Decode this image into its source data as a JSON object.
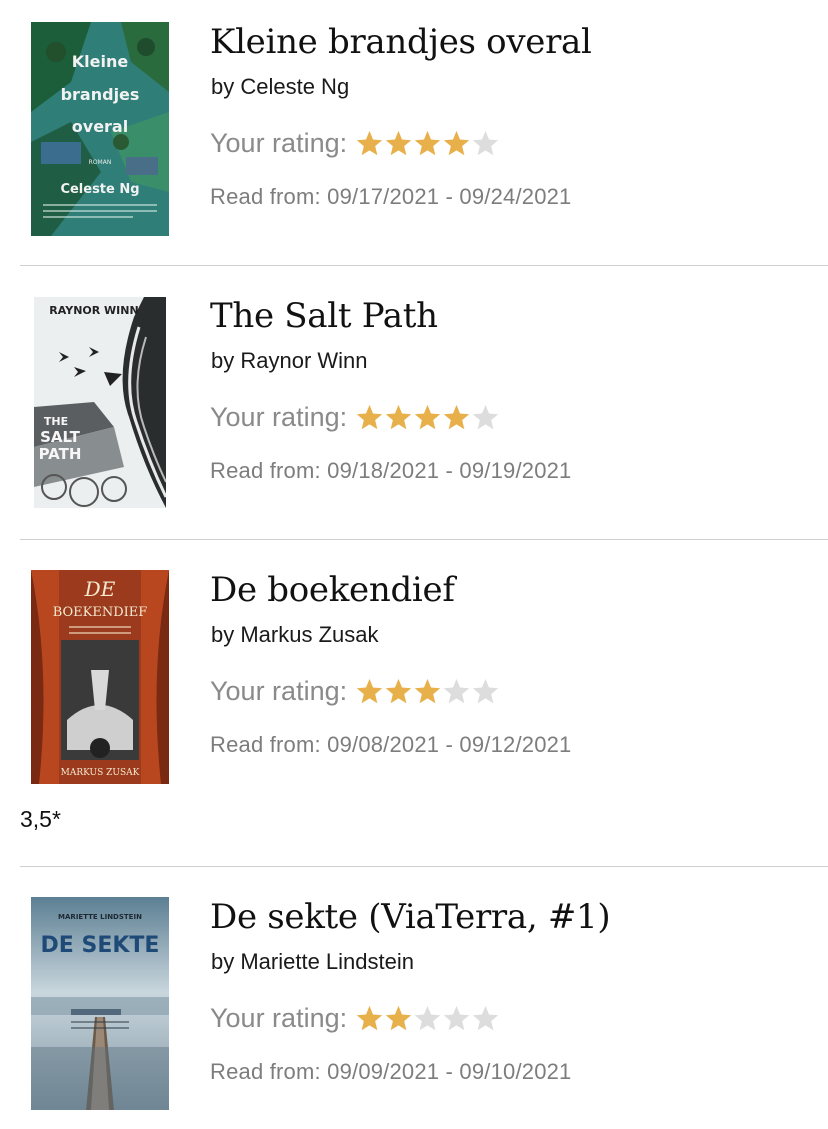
{
  "rating_label": "Your rating:",
  "colors": {
    "star_filled": "#E8B04A",
    "star_empty": "#DDDDDD",
    "divider": "#CFCFCF"
  },
  "books": [
    {
      "title": "Kleine brandjes overal",
      "author": "by Celeste Ng",
      "rating": 4,
      "dates": "Read from: 09/17/2021 - 09/24/2021",
      "cover": {
        "lines": [
          "Kleine",
          "brandjes",
          "overal"
        ],
        "sub": "ROMAN",
        "author": "Celeste Ng"
      }
    },
    {
      "title": "The Salt Path",
      "author": "by Raynor Winn",
      "rating": 4,
      "dates": "Read from: 09/18/2021 - 09/19/2021",
      "cover": {
        "top": "RAYNOR WINN",
        "lines": [
          "THE",
          "SALT",
          "PATH"
        ]
      }
    },
    {
      "title": "De boekendief",
      "author": "by Markus Zusak",
      "rating": 3,
      "dates": "Read from: 09/08/2021 - 09/12/2021",
      "note": "3,5*",
      "cover": {
        "lines": [
          "DE",
          "BOEKENDIEF"
        ],
        "author": "MARKUS ZUSAK"
      }
    },
    {
      "title": "De sekte (ViaTerra, #1)",
      "author": "by Mariette Lindstein",
      "rating": 2,
      "dates": "Read from: 09/09/2021 - 09/10/2021",
      "cover": {
        "top": "MARIETTE LINDSTEIN",
        "lines": [
          "DE SEKTE"
        ]
      }
    }
  ]
}
